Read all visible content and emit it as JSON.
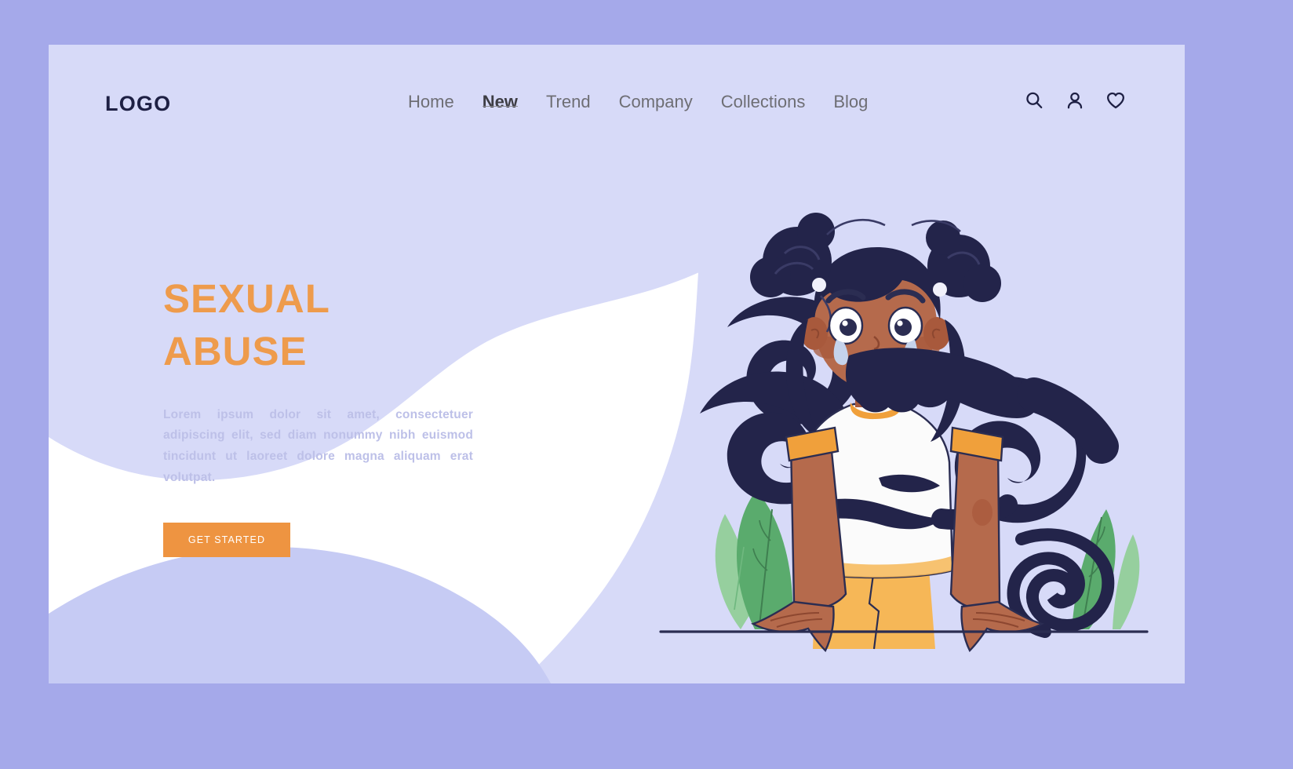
{
  "site": {
    "logo_text": "LOGO"
  },
  "nav": {
    "items": [
      {
        "label": "Home",
        "active": false
      },
      {
        "label": "New",
        "active": true
      },
      {
        "label": "Trend",
        "active": false
      },
      {
        "label": "Company",
        "active": false
      },
      {
        "label": "Collections",
        "active": false
      },
      {
        "label": "Blog",
        "active": false
      }
    ],
    "icons": [
      {
        "name": "search-icon"
      },
      {
        "name": "user-icon"
      },
      {
        "name": "heart-icon"
      }
    ]
  },
  "hero": {
    "headline_line1": "SEXUAL",
    "headline_line2": "ABUSE",
    "body": "Lorem ipsum dolor sit amet, consectetuer adipiscing elit, sed diam nonummy nibh euismod tincidunt ut laoreet dolore magna aliquam erat volutpat.",
    "cta_label": "GET STARTED"
  },
  "colors": {
    "frame": "#a5a9ea",
    "card": "#ffffff",
    "blob_light": "#d7daf8",
    "blob_mid": "#c6cbf4",
    "accent_orange": "#ee9441",
    "headline_orange": "#ee9b4c",
    "body_text": "#bdc0e8",
    "logo_navy": "#1e2044",
    "nav_grey": "#6e6e74",
    "nav_active": "#3d3d44",
    "hair_navy": "#23244a",
    "skin": "#b56a4c",
    "shirt_white": "#fbfbfb",
    "skirt_yellow": "#f6b757",
    "leaf_green": "#5aab6d",
    "leaf_green_light": "#96cf9e"
  },
  "illustration": {
    "alt": "Illustration of a distressed girl with tears, a hand covering her mouth and arms gripping her, flanked by green plant leaves"
  }
}
